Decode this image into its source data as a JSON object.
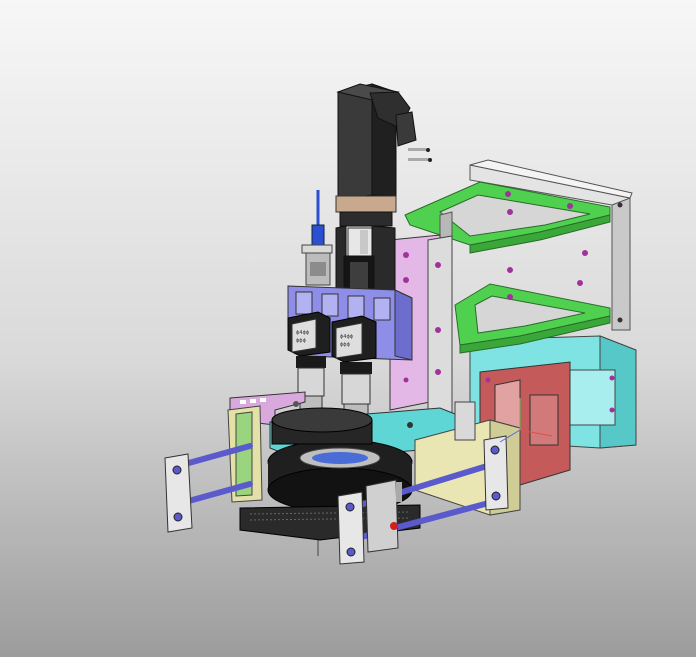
{
  "viewport": {
    "background_top": "#f7f7f7",
    "background_bottom": "#9c9c9c"
  },
  "parts": {
    "motor": {
      "color": "#2b2b2b"
    },
    "frame_green": {
      "color": "#4fd14f"
    },
    "frame_white": {
      "color": "#e4e4e4"
    },
    "plate_pink": {
      "color": "#e4b8e6"
    },
    "plate_lavender": {
      "color": "#8e8ee8"
    },
    "base_cyan": {
      "color": "#5fd6d6"
    },
    "block_red": {
      "color": "#c45a5a"
    },
    "rod_blue": {
      "color": "#5a5acd"
    },
    "plate_yellow": {
      "color": "#e9e6b4"
    },
    "turntable_black": {
      "color": "#1f1f1f"
    }
  },
  "camera_labels": {
    "left": [
      "ϕ4ϕϕ",
      "ϕϕϕ"
    ],
    "right": [
      "ϕ4ϕϕ",
      "ϕϕϕ"
    ]
  }
}
